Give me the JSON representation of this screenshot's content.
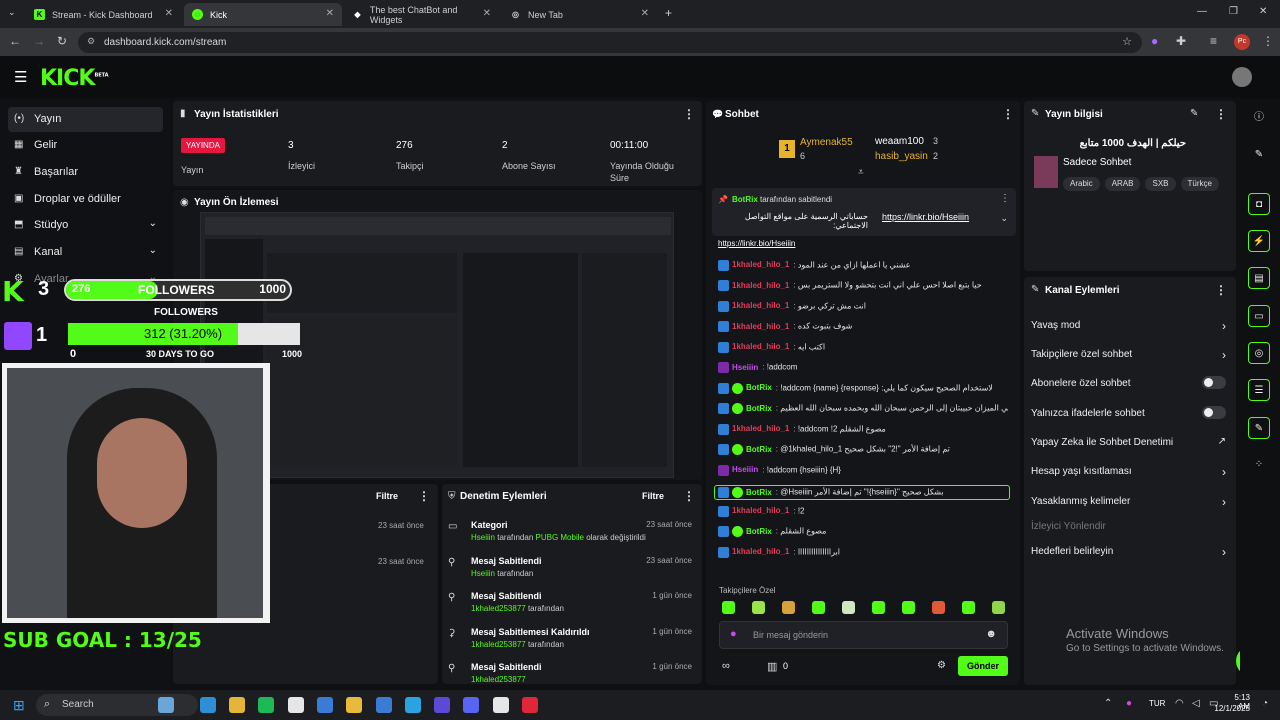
{
  "browser": {
    "tabs": [
      {
        "title": "Stream - Kick Dashboard",
        "active": false
      },
      {
        "title": "Kick",
        "active": true
      },
      {
        "title": "The best ChatBot and Widgets",
        "active": false
      },
      {
        "title": "New Tab",
        "active": false
      }
    ],
    "url": "dashboard.kick.com/stream",
    "profile_initials": "Pc"
  },
  "sidebar": {
    "items": [
      {
        "label": "Yayın",
        "icon": "live-icon"
      },
      {
        "label": "Gelir",
        "icon": "revenue-icon"
      },
      {
        "label": "Başarılar",
        "icon": "trophy-icon"
      },
      {
        "label": "Droplar ve ödüller",
        "icon": "gift-icon"
      },
      {
        "label": "Stüdyo",
        "icon": "studio-icon"
      },
      {
        "label": "Kanal",
        "icon": "channel-icon"
      },
      {
        "label": "Ayarlar",
        "icon": "settings-icon"
      }
    ]
  },
  "stats": {
    "title": "Yayın İstatistikleri",
    "live_badge": "YAYINDA",
    "items": [
      {
        "value": "",
        "label": "Yayın"
      },
      {
        "value": "3",
        "label": "İzleyici"
      },
      {
        "value": "276",
        "label": "Takipçi"
      },
      {
        "value": "2",
        "label": "Abone Sayısı"
      },
      {
        "value": "00:11:00",
        "label": "Yayında Olduğu Süre"
      }
    ]
  },
  "preview": {
    "title": "Yayın Ön İzlemesi"
  },
  "overlay": {
    "followers_count": "276",
    "followers_label": "FOLLOWERS",
    "followers_goal": "1000",
    "followers_sub": "FOLLOWERS",
    "kick_count": "3",
    "twitch_count": "1",
    "progress_text": "312 (31.20%)",
    "progress_fraction": 0.312,
    "progress_start": "0",
    "progress_end": "1000",
    "days": "30 DAYS TO GO",
    "sub_goal": "SUB GOAL : 13/25"
  },
  "filters": {
    "label": "Filtre"
  },
  "left_log": {
    "times": [
      "23 saat önce",
      "23 saat önce"
    ]
  },
  "mod_actions": {
    "title": "Denetim Eylemleri",
    "filter": "Filtre",
    "rows": [
      {
        "title": "Kategori",
        "user": "Hseiiin",
        "text": " tarafından ",
        "highlight": "PUBG Mobile",
        "tail": " olarak değiştirildi",
        "time": "23 saat önce",
        "icon": "category-icon"
      },
      {
        "title": "Mesaj Sabitlendi",
        "user": "Hseiiin",
        "text": " tarafından",
        "highlight": "",
        "tail": "",
        "time": "23 saat önce",
        "icon": "pin-icon"
      },
      {
        "title": "Mesaj Sabitlendi",
        "user": "1khaled253877",
        "text": " tarafından",
        "highlight": "",
        "tail": "",
        "time": "1 gün önce",
        "icon": "pin-icon"
      },
      {
        "title": "Mesaj Sabitlemesi Kaldırıldı",
        "user": "1khaled253877",
        "text": " tarafından",
        "highlight": "",
        "tail": "",
        "time": "1 gün önce",
        "icon": "unpin-icon"
      },
      {
        "title": "Mesaj Sabitlendi",
        "user": "1khaled253877",
        "text": "",
        "highlight": "",
        "tail": "",
        "time": "1 gün önce",
        "icon": "pin-icon"
      }
    ]
  },
  "chat": {
    "title": "Sohbet",
    "leaderboard": [
      {
        "rank": "1",
        "name": "Aymenak55",
        "count": "6"
      },
      {
        "rank": "",
        "name": "weaam100",
        "count": "3"
      },
      {
        "rank": "",
        "name": "hasib_yasin",
        "count": "2"
      }
    ],
    "pinned_by": "BotRix",
    "pinned_by_suffix": " tarafından sabitlendi",
    "pinned_text": "حساباتي الرسمية على مواقع التواصل الاجتماعي:",
    "pinned_link": "https://linkr.bio/Hseiiin",
    "messages": [
      {
        "user": "",
        "text": "https://linkr.bio/Hseiiin",
        "color": "link"
      },
      {
        "user": "1khaled_hilo_1",
        "text": "عشني يا اعملها ازاي من عند المود",
        "color": "red"
      },
      {
        "user": "1khaled_hilo_1",
        "text": "حيا بتبع اصلا احس علي اني انت بتحشو ولا الستريمر بس",
        "color": "red"
      },
      {
        "user": "1khaled_hilo_1",
        "text": "انت مش تركي برضو",
        "color": "red"
      },
      {
        "user": "1khaled_hilo_1",
        "text": "شوف بتبوت كده",
        "color": "red"
      },
      {
        "user": "1khaled_hilo_1",
        "text": "اكتب ايه",
        "color": "red"
      },
      {
        "user": "Hseiiin",
        "text": "!addcom",
        "color": "pur"
      },
      {
        "user": "BotRix",
        "text": "!addcom {name} {response} :لاستخدام الصحيح سيكون كما يلي",
        "color": "grn"
      },
      {
        "user": "BotRix",
        "text": "كلمتان خفيفتان على اللسان ثقيلتان في الميزان حبيبتان إلى الرحمن سبحان الله وبحمده سبحان الله العظيم",
        "color": "grn"
      },
      {
        "user": "1khaled_hilo_1",
        "text": "!addcom !2 مصوع الشقلم",
        "color": "red"
      },
      {
        "user": "BotRix",
        "text": "@1khaled_hilo_1 تم إضافة الأمر \"!2\" بشكل صحيح",
        "color": "grn"
      },
      {
        "user": "Hseiiin",
        "text": "!addcom {hseiiin} {H}",
        "color": "pur"
      },
      {
        "user": "BotRix",
        "text": "@Hseiiin تم إضافة الأمر \"!{hseiiin}\" بشكل صحيح",
        "color": "grn"
      },
      {
        "user": "1khaled_hilo_1",
        "text": "!2",
        "color": "red"
      },
      {
        "user": "BotRix",
        "text": "مصوع الشقلم",
        "color": "grn"
      },
      {
        "user": "1khaled_hilo_1",
        "text": "ابرااااااااااااااا",
        "color": "red"
      }
    ],
    "followers_only": "Takipçilere Özel",
    "input_placeholder": "Bir mesaj gönderin",
    "points": "0",
    "send_label": "Gönder"
  },
  "stream_info": {
    "title": "Yayın bilgisi",
    "stream_title": "حيلكم | الهدف 1000 متابع",
    "category": "Sadece Sohbet",
    "tags": [
      "Arabic",
      "ARAB",
      "SXB",
      "Türkçe"
    ]
  },
  "channel_actions": {
    "title": "Kanal Eylemleri",
    "items": [
      {
        "label": "Yavaş mod",
        "control": "chevron"
      },
      {
        "label": "Takipçilere özel sohbet",
        "control": "chevron"
      },
      {
        "label": "Abonelere özel sohbet",
        "control": "toggle"
      },
      {
        "label": "Yalnızca ifadelerle sohbet",
        "control": "toggle"
      },
      {
        "label": "Yapay Zeka ile Sohbet Denetimi",
        "control": "external"
      },
      {
        "label": "Hesap yaşı kısıtlaması",
        "control": "chevron"
      },
      {
        "label": "Yasaklanmış kelimeler",
        "control": "chevron"
      },
      {
        "label": "İzleyici Yönlendir",
        "control": "none"
      },
      {
        "label": "Hedefleri belirleyin",
        "control": "chevron"
      }
    ]
  },
  "watermark": {
    "title": "Activate Windows",
    "subtitle": "Go to Settings to activate Windows."
  },
  "taskbar": {
    "search_placeholder": "Search",
    "lang": "TUR",
    "time": "5:13 AM",
    "date": "12/1/2025"
  },
  "colors": {
    "kick_green": "#53fc18",
    "panel": "#191b1f",
    "live_red": "#e5173f"
  }
}
